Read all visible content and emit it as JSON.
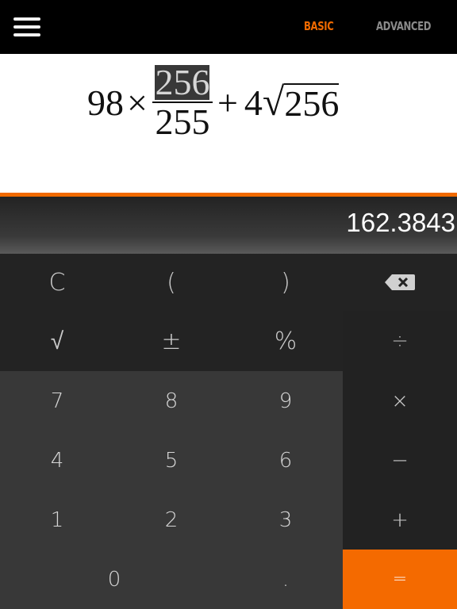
{
  "header": {
    "tabs": [
      {
        "label": "BASIC",
        "active": true,
        "color": "#f06a00"
      },
      {
        "label": "ADVANCED",
        "active": false,
        "color": "#8a8a8a"
      }
    ],
    "menu_icon": "hamburger-menu-icon"
  },
  "expression": {
    "a": "98",
    "times": "×",
    "frac_num": "256",
    "frac_den": "255",
    "plus": "+",
    "coef": "4",
    "radical": "√",
    "radicand": "256"
  },
  "display": {
    "result": "162.3843"
  },
  "keypad": {
    "row1": [
      "C",
      "(",
      ")",
      "backspace-icon"
    ],
    "row2": [
      "√",
      "±",
      "%",
      "÷"
    ],
    "row3": [
      "7",
      "8",
      "9",
      "×"
    ],
    "row4": [
      "4",
      "5",
      "6",
      "−"
    ],
    "row5": [
      "1",
      "2",
      "3",
      "+"
    ],
    "row6": [
      "0",
      ".",
      "="
    ]
  },
  "colors": {
    "accent": "#f06a00",
    "background": "#1a1a1a"
  }
}
